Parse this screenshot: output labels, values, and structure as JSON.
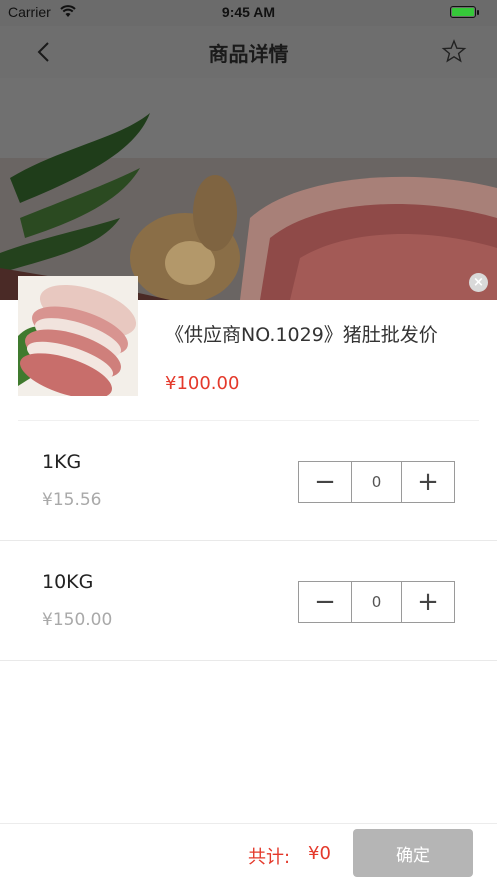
{
  "status_bar": {
    "carrier": "Carrier",
    "time": "9:45 AM",
    "battery_level": 1.0
  },
  "navbar": {
    "title": "商品详情"
  },
  "product": {
    "name": "《供应商NO.1029》猪肚批发价",
    "price": "¥100.00"
  },
  "specs": [
    {
      "label": "1KG",
      "price": "¥15.56",
      "quantity": "0",
      "minus": "−",
      "plus": "+"
    },
    {
      "label": "10KG",
      "price": "¥150.00",
      "quantity": "0",
      "minus": "−",
      "plus": "+"
    }
  ],
  "footer": {
    "total_label": "共计:",
    "total_value": "¥0",
    "confirm_label": "确定"
  },
  "colors": {
    "accent": "#e4392b",
    "confirm_bg": "#b5b5b5",
    "muted": "#a9a9a9"
  }
}
